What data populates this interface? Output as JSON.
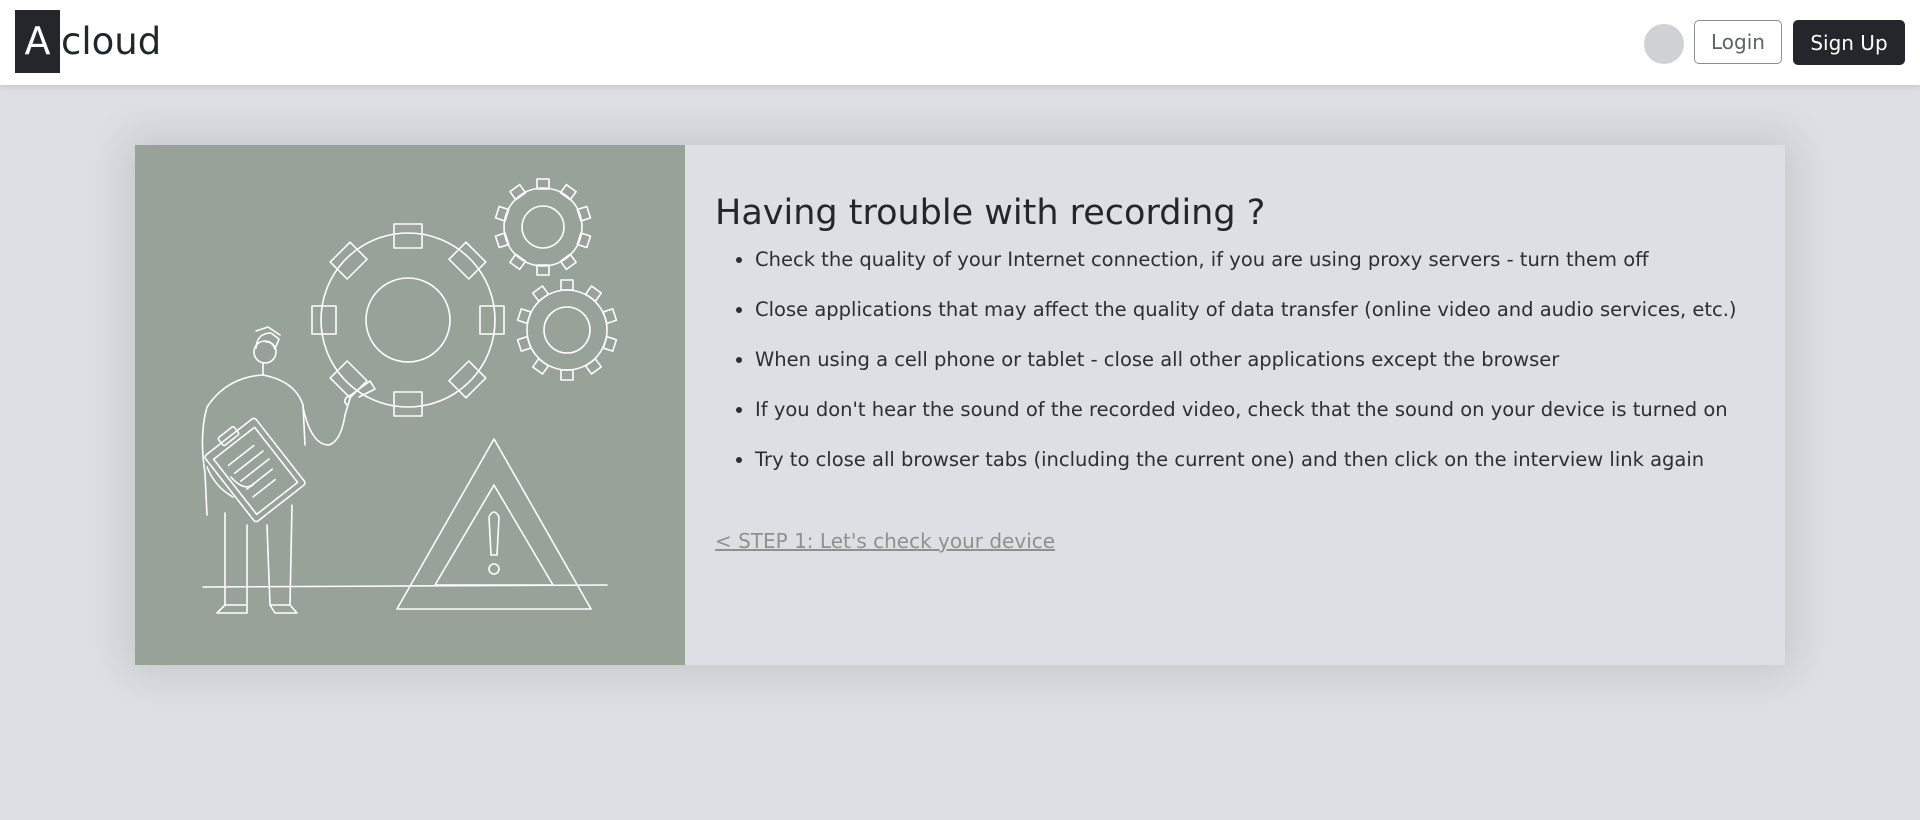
{
  "header": {
    "logo_letter": "A",
    "logo_text": "cloud",
    "language_label": "",
    "login_label": "Login",
    "signup_label": "Sign Up"
  },
  "colors": {
    "header_bg": "#ffffff",
    "page_bg": "#dcdfe3",
    "illustration_bg": "#98a299",
    "primary_dark": "#23272b",
    "link_gray": "#8d9190"
  },
  "card": {
    "illustration_icon": "mechanic-gears-warning-illustration",
    "title": "Having trouble with recording ?",
    "tips": [
      "Check the quality of your Internet connection, if you are using proxy servers - turn them off",
      "Close applications that may affect the quality of data transfer (online video and audio services, etc.)",
      "When using a cell phone or tablet - close all other applications except the browser",
      "If you don't hear the sound of the recorded video, check that the sound on your device is turned on",
      "Try to close all browser tabs (including the current one) and then click on the interview link again"
    ],
    "back_link": "< STEP 1: Let's check your device"
  }
}
